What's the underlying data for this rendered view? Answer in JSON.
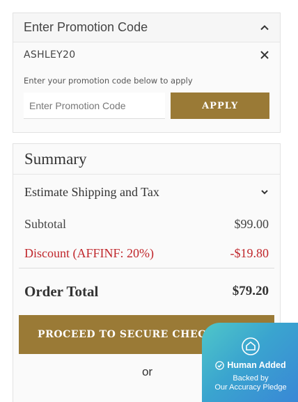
{
  "promo": {
    "title": "Enter Promotion Code",
    "applied_code": "ASHLEY20",
    "help_text": "Enter your promotion code below to apply",
    "input_placeholder": "Enter Promotion Code",
    "input_value": "",
    "apply_label": "APPLY"
  },
  "summary": {
    "title": "Summary",
    "shipping_label": "Estimate Shipping and Tax",
    "subtotal_label": "Subtotal",
    "subtotal_value": "$99.00",
    "discount_label": "Discount (AFFINF: 20%)",
    "discount_value": "-$19.80",
    "total_label": "Order Total",
    "total_value": "$79.20",
    "checkout_label": "PROCEED TO SECURE CHECKOUT",
    "or_text": "or"
  },
  "badge": {
    "headline": "Human Added",
    "line1": "Backed by",
    "line2": "Our Accuracy Pledge"
  },
  "colors": {
    "accent_gold": "#9a7a36",
    "discount_red": "#c0262b",
    "badge_teal": "#4fc7c9",
    "badge_blue": "#3987d6"
  },
  "icons": {
    "collapse": "chevron-up-icon",
    "remove": "close-icon",
    "expand": "chevron-down-icon",
    "lock": "lock-icon",
    "seal": "shield-home-icon",
    "check": "check-circle-icon"
  }
}
